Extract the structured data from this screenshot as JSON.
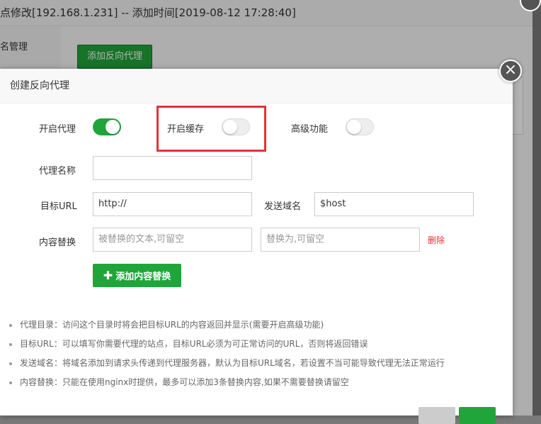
{
  "background": {
    "title": "点修改[192.168.1.231] -- 添加时间[2019-08-12 17:28:40]",
    "sidebar_item": "名管理",
    "add_proxy_button": "添加反向代理"
  },
  "dialog": {
    "title": "创建反向代理",
    "close_icon": "close-icon",
    "toggles": {
      "proxy_label": "开启代理",
      "proxy_on": true,
      "cache_label": "开启缓存",
      "cache_on": false,
      "advanced_label": "高级功能",
      "advanced_on": false
    },
    "fields": {
      "proxy_name_label": "代理名称",
      "proxy_name_value": "",
      "target_url_label": "目标URL",
      "target_url_value": "http://",
      "send_domain_label": "发送域名",
      "send_domain_value": "$host",
      "content_replace_label": "内容替换",
      "replace_from_placeholder": "被替换的文本,可留空",
      "replace_to_placeholder": "替换为,可留空",
      "delete_label": "删除",
      "add_replace_button": "添加内容替换"
    },
    "notes": [
      "代理目录：访问这个目录时将会把目标URL的内容返回并显示(需要开启高级功能)",
      "目标URL：可以填写你需要代理的站点，目标URL必须为可正常访问的URL，否则将返回错误",
      "发送域名：将域名添加到请求头传递到代理服务器，默认为目标URL域名，若设置不当可能导致代理无法正常运行",
      "内容替换：只能在使用nginx时提供，最多可以添加3条替换内容,如果不需要替换请留空"
    ]
  },
  "colors": {
    "accent": "#20a53a",
    "highlight": "#e53238",
    "danger": "#e53238"
  }
}
